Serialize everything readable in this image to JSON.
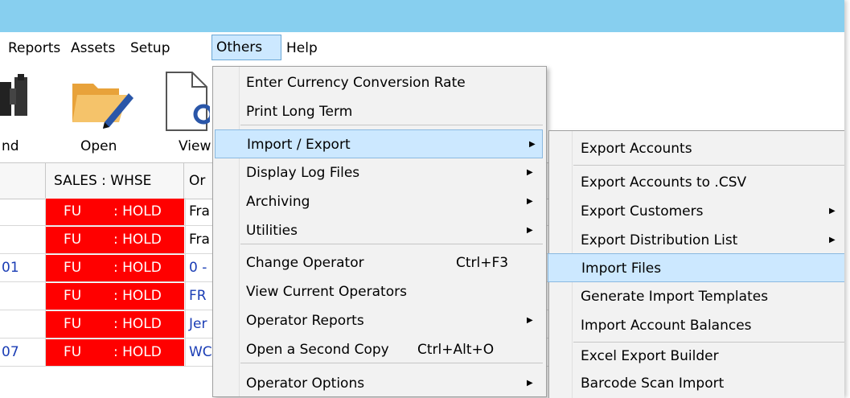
{
  "menubar": {
    "items": [
      "Reports",
      "Assets",
      "Setup",
      "Others",
      "Help"
    ]
  },
  "toolbar": {
    "find_label": "nd",
    "open_label": "Open",
    "view_label": "View"
  },
  "grid": {
    "headers": [
      "SALES : WHSE",
      "Or"
    ],
    "rows": [
      {
        "num": "",
        "sales": "FU",
        "whse": ": HOLD",
        "order": "Fra",
        "order_color": "#000000"
      },
      {
        "num": "",
        "sales": "FU",
        "whse": ": HOLD",
        "order": "Fra",
        "order_color": "#000000"
      },
      {
        "num": "01",
        "sales": "FU",
        "whse": ": HOLD",
        "order": "0 -",
        "order_color": "#1a3db5"
      },
      {
        "num": "",
        "sales": "FU",
        "whse": ": HOLD",
        "order": "FR",
        "order_color": "#1a3db5"
      },
      {
        "num": "",
        "sales": "FU",
        "whse": ": HOLD",
        "order": "Jer",
        "order_color": "#1a3db5"
      },
      {
        "num": "07",
        "sales": "FU",
        "whse": ": HOLD",
        "order": "WC",
        "order_color": "#1a3db5"
      }
    ],
    "status_color": "#ff0000"
  },
  "others_menu": {
    "items": [
      {
        "label": "Enter Currency Conversion Rate",
        "shortcut": "",
        "submenu": false
      },
      {
        "label": "Print Long Term",
        "shortcut": "",
        "submenu": false
      },
      {
        "label": "Import / Export",
        "shortcut": "",
        "submenu": true
      },
      {
        "label": "Display Log Files",
        "shortcut": "",
        "submenu": true
      },
      {
        "label": "Archiving",
        "shortcut": "",
        "submenu": true
      },
      {
        "label": "Utilities",
        "shortcut": "",
        "submenu": true
      },
      {
        "label": "Change Operator",
        "shortcut": "Ctrl+F3",
        "submenu": false
      },
      {
        "label": "View Current Operators",
        "shortcut": "",
        "submenu": false
      },
      {
        "label": "Operator Reports",
        "shortcut": "",
        "submenu": true
      },
      {
        "label": "Open a Second Copy",
        "shortcut": "Ctrl+Alt+O",
        "submenu": false
      },
      {
        "label": "Operator Options",
        "shortcut": "",
        "submenu": true
      }
    ]
  },
  "import_export_menu": {
    "items": [
      {
        "label": "Export Accounts",
        "submenu": false
      },
      {
        "label": "Export Accounts to .CSV",
        "submenu": false
      },
      {
        "label": "Export Customers",
        "submenu": true
      },
      {
        "label": "Export Distribution List",
        "submenu": true
      },
      {
        "label": "Import Files",
        "submenu": false
      },
      {
        "label": "Generate Import Templates",
        "submenu": false
      },
      {
        "label": "Import Account Balances",
        "submenu": false
      },
      {
        "label": "Excel Export Builder",
        "submenu": false
      },
      {
        "label": "Barcode Scan Import",
        "submenu": false
      }
    ]
  },
  "colors": {
    "titlebar": "#87cfef",
    "highlight": "#cce8ff",
    "link_blue": "#1a3db5"
  }
}
